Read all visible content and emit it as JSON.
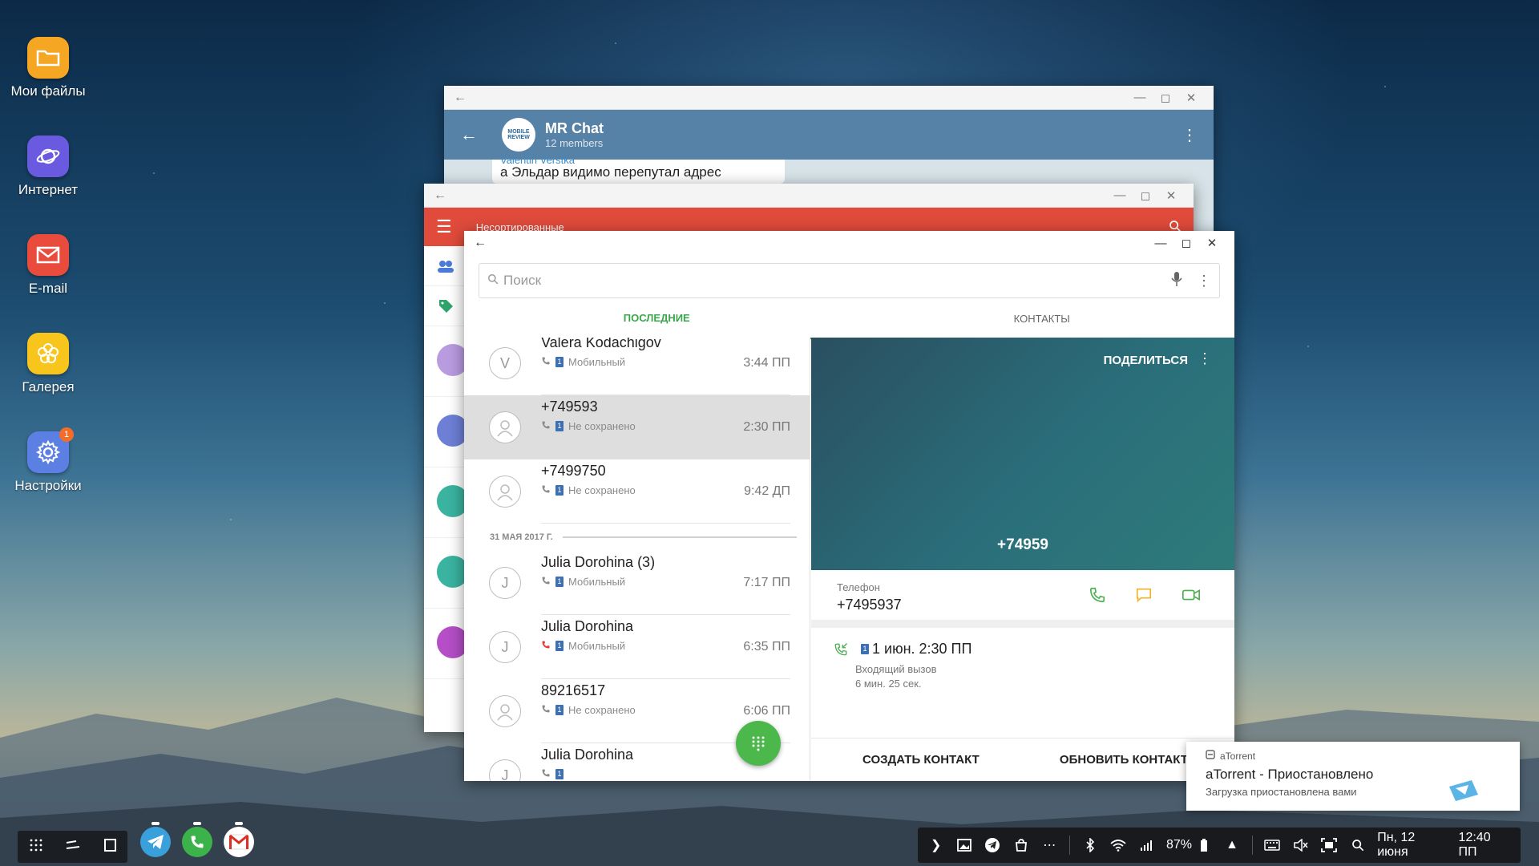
{
  "colors": {
    "telegram_header": "#5782a8",
    "email_header": "#e04b3b",
    "phone_accent": "#3aa84a",
    "hero_bg": "#2a6e7a",
    "sim_badge": "#3d6fb3"
  },
  "desktop": {
    "icons": [
      {
        "label": "Мои файлы",
        "icon": "folder-icon",
        "color": "#f5a623"
      },
      {
        "label": "Интернет",
        "icon": "planet-icon",
        "color": "#6a5ae0"
      },
      {
        "label": "E-mail",
        "icon": "email-icon",
        "color": "#e94b3c"
      },
      {
        "label": "Галерея",
        "icon": "flower-icon",
        "color": "#f8c51c"
      },
      {
        "label": "Настройки",
        "icon": "gear-icon",
        "color": "#5b7fe3",
        "badge": "1"
      }
    ]
  },
  "telegram": {
    "chat_title": "MR Chat",
    "chat_subtitle": "12 members",
    "avatar_text": "MOBILE REVIEW",
    "message_author": "Valentin Verstka",
    "message_text": "а Эльдар видимо перепутал адрес"
  },
  "email": {
    "folder_title": "Несортированные"
  },
  "phone": {
    "search_placeholder": "Поиск",
    "tabs": [
      "ПОСЛЕДНИЕ",
      "КОНТАКТЫ"
    ],
    "active_tab": 0,
    "calls_group1": [
      {
        "name": "Valera Kodachigov",
        "avatar": "V",
        "sub": "Мобильный",
        "time": "3:44 ПП",
        "type": "incoming"
      },
      {
        "name": "+749593",
        "avatar": "person",
        "sub": "Не сохранено",
        "time": "2:30 ПП",
        "type": "incoming",
        "selected": true
      },
      {
        "name": "+7499750",
        "avatar": "person",
        "sub": "Не сохранено",
        "time": "9:42 ДП",
        "type": "incoming"
      }
    ],
    "date_separator": "31 МАЯ 2017 Г.",
    "calls_group2": [
      {
        "name": "Julia Dorohina (3)",
        "avatar": "J",
        "sub": "Мобильный",
        "time": "7:17 ПП",
        "type": "incoming"
      },
      {
        "name": "Julia Dorohina",
        "avatar": "J",
        "sub": "Мобильный",
        "time": "6:35 ПП",
        "type": "missed"
      },
      {
        "name": "89216517",
        "avatar": "person",
        "sub": "Не сохранено",
        "time": "6:06 ПП",
        "type": "incoming"
      },
      {
        "name": "Julia Dorohina",
        "avatar": "J",
        "sub": "",
        "time": "",
        "type": "incoming"
      }
    ],
    "detail": {
      "share_label": "ПОДЕЛИТЬСЯ",
      "hero_number": "+74959",
      "phone_label": "Телефон",
      "phone_value": "+7495937",
      "history_title": "1 июн. 2:30 ПП",
      "history_type": "Входящий вызов",
      "history_duration": "6 мин. 25 сек.",
      "create_contact": "СОЗДАТЬ КОНТАКТ",
      "update_contact": "ОБНОВИТЬ КОНТАКТ"
    }
  },
  "notification": {
    "app": "aTorrent",
    "title": "aTorrent - Приостановлено",
    "text": "Загрузка приостановлена вами"
  },
  "taskbar": {
    "battery": "87%",
    "date": "Пн, 12 июня",
    "time": "12:40 ПП"
  }
}
